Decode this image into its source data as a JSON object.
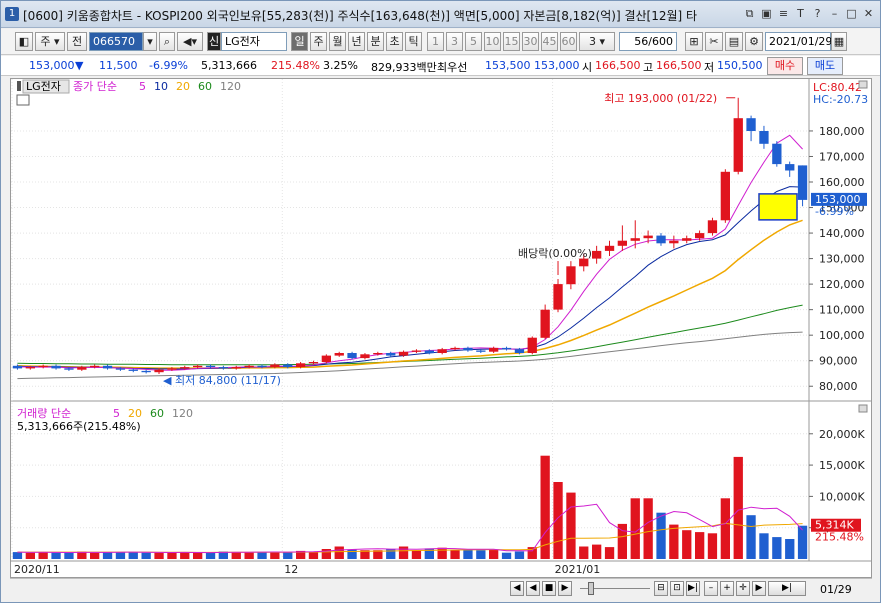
{
  "window": {
    "number": "1",
    "title": "[0600] 키움종합차트 - KOSPI200 외국인보유[55,283(천)] 주식수[163,648(천)] 액면[5,000] 자본금[8,182(억)] 결산[12월] 타"
  },
  "toolbar": {
    "market": "주",
    "prev": "전",
    "code": "066570",
    "stock_badge": "신",
    "stock_name": "LG전자",
    "periods": [
      "일",
      "주",
      "월",
      "년",
      "분",
      "초",
      "틱"
    ],
    "selected_period": "일",
    "intervals": [
      "1",
      "3",
      "5",
      "10",
      "15",
      "30",
      "45",
      "60"
    ],
    "interval_value": "3",
    "count": "56/600",
    "date": "2021/01/29"
  },
  "info": {
    "price": "153,000",
    "arrow": "▼",
    "change": "11,500",
    "change_pct": "-6.99%",
    "volume": "5,313,666",
    "volume_pct": "215.48%",
    "turnover": "3.25%",
    "amount": "829,933백만",
    "best_ask_label": "최우선",
    "best_ask": "153,500",
    "best_bid": "153,000",
    "open_label": "시",
    "open": "166,500",
    "high_label": "고",
    "high": "166,500",
    "low_label": "저",
    "low": "150,500",
    "buy_label": "매수",
    "sell_label": "매도"
  },
  "price_panel": {
    "legend_name": "LG전자",
    "legend_ma": "종가 단순",
    "ma_periods": [
      "5",
      "10",
      "20",
      "60",
      "120"
    ],
    "lc": "LC:80.42",
    "hc": "HC:-20.73",
    "y_ticks": [
      "180,000",
      "170,000",
      "160,000",
      "150,000",
      "140,000",
      "130,000",
      "120,000",
      "110,000",
      "100,000",
      "90,000",
      "80,000"
    ],
    "current_price_tag": "153,000",
    "current_pct_tag": "-6.99%",
    "high_annotation": "최고 193,000 (01/22)",
    "low_annotation": "최저 84,800 (11/17)",
    "dividend_annotation": "배당락(0.00%)"
  },
  "volume_panel": {
    "legend_name": "거래량",
    "legend_ma": "단순",
    "ma_periods": [
      "5",
      "20",
      "60",
      "120"
    ],
    "summary": "5,313,666주(215.48%)",
    "y_ticks": [
      "20,000K",
      "15,000K",
      "10,000K",
      "5,000K"
    ],
    "volume_tag": "5,314K",
    "volume_pct_tag": "215.48%"
  },
  "x_labels": [
    "2020/11",
    "12",
    "2021/01"
  ],
  "x_end_label": "01/29",
  "colors": {
    "up": "#e0141e",
    "down": "#1f5fd0",
    "ma5": "#d01fd0",
    "ma10": "#0a2aa0",
    "ma20": "#f0a800",
    "ma60": "#1c8a1c",
    "ma120": "#808080"
  },
  "chart_data": {
    "type": "candlestick",
    "x": [
      "2020-11-02",
      "2020-11-03",
      "2020-11-04",
      "2020-11-05",
      "2020-11-06",
      "2020-11-09",
      "2020-11-10",
      "2020-11-11",
      "2020-11-12",
      "2020-11-13",
      "2020-11-16",
      "2020-11-17",
      "2020-11-18",
      "2020-11-19",
      "2020-11-20",
      "2020-11-23",
      "2020-11-24",
      "2020-11-25",
      "2020-11-26",
      "2020-11-27",
      "2020-11-30",
      "2020-12-01",
      "2020-12-02",
      "2020-12-03",
      "2020-12-04",
      "2020-12-07",
      "2020-12-08",
      "2020-12-09",
      "2020-12-10",
      "2020-12-11",
      "2020-12-14",
      "2020-12-15",
      "2020-12-16",
      "2020-12-17",
      "2020-12-18",
      "2020-12-21",
      "2020-12-22",
      "2020-12-23",
      "2020-12-24",
      "2020-12-28",
      "2020-12-29",
      "2020-12-30",
      "2021-01-04",
      "2021-01-05",
      "2021-01-06",
      "2021-01-07",
      "2021-01-08",
      "2021-01-11",
      "2021-01-12",
      "2021-01-13",
      "2021-01-14",
      "2021-01-15",
      "2021-01-18",
      "2021-01-19",
      "2021-01-20",
      "2021-01-21",
      "2021-01-22",
      "2021-01-25",
      "2021-01-26",
      "2021-01-27",
      "2021-01-28",
      "2021-01-29"
    ],
    "open": [
      88000,
      87000,
      87500,
      88000,
      87000,
      86500,
      87500,
      88000,
      87000,
      86500,
      86000,
      85500,
      86500,
      87000,
      87500,
      88000,
      87500,
      87000,
      87500,
      88000,
      87500,
      88500,
      87500,
      89000,
      89500,
      92000,
      93000,
      91000,
      92500,
      93000,
      92000,
      93500,
      94000,
      93000,
      94500,
      95000,
      94000,
      93500,
      95000,
      94500,
      93000,
      99000,
      110000,
      120000,
      127000,
      130000,
      133000,
      135000,
      137000,
      138000,
      139000,
      136000,
      137000,
      138000,
      140000,
      145000,
      164000,
      185000,
      180000,
      175000,
      167000,
      166500
    ],
    "close": [
      87000,
      87500,
      88000,
      87000,
      86500,
      87500,
      88000,
      87000,
      86500,
      86000,
      85500,
      86500,
      87000,
      87500,
      88000,
      87500,
      87000,
      87500,
      88000,
      87500,
      88500,
      87500,
      89000,
      89500,
      92000,
      93000,
      91000,
      92500,
      93000,
      92000,
      93500,
      94000,
      93000,
      94500,
      95000,
      94000,
      93500,
      95000,
      94500,
      93000,
      99000,
      110000,
      120000,
      127000,
      130000,
      133000,
      135000,
      137000,
      138000,
      139000,
      136000,
      137000,
      138000,
      140000,
      145000,
      164000,
      185000,
      180000,
      175000,
      167000,
      164500,
      153000
    ],
    "high": [
      88500,
      88000,
      88500,
      88500,
      87500,
      88000,
      88500,
      88500,
      87500,
      87000,
      86500,
      87000,
      87500,
      88000,
      88500,
      88500,
      88000,
      88000,
      88500,
      88500,
      89000,
      89000,
      89500,
      90000,
      92500,
      93500,
      93500,
      93000,
      93500,
      93500,
      94000,
      94500,
      94500,
      95000,
      95500,
      95500,
      94500,
      95500,
      95500,
      95000,
      99500,
      112000,
      122000,
      129000,
      132000,
      135000,
      137000,
      143000,
      145000,
      141000,
      140000,
      139000,
      139000,
      141000,
      146000,
      165000,
      193000,
      186000,
      182000,
      176000,
      168000,
      166500
    ],
    "low": [
      86500,
      86500,
      87000,
      86500,
      86000,
      86000,
      87000,
      86500,
      86000,
      85500,
      85000,
      84800,
      86000,
      86500,
      87000,
      87000,
      86500,
      86500,
      87000,
      87000,
      87000,
      87000,
      87000,
      88500,
      89000,
      91500,
      90500,
      90500,
      92000,
      91500,
      91500,
      93000,
      92500,
      92500,
      94000,
      93500,
      93000,
      93000,
      94000,
      92500,
      92500,
      98500,
      109000,
      118000,
      125000,
      128000,
      131000,
      133000,
      134000,
      136000,
      135000,
      134000,
      136000,
      137000,
      139000,
      144000,
      163000,
      176000,
      173000,
      166000,
      162000,
      150500
    ],
    "volume_k": [
      1100,
      1000,
      1100,
      1000,
      1000,
      1200,
      1000,
      1100,
      1100,
      1100,
      1000,
      1000,
      1000,
      1100,
      1000,
      1000,
      1200,
      1100,
      1100,
      1100,
      1100,
      1100,
      1300,
      1200,
      1600,
      2000,
      1500,
      1400,
      1400,
      1600,
      2000,
      1400,
      1700,
      1800,
      1400,
      1500,
      1400,
      1500,
      1000,
      1200,
      1900,
      16500,
      12300,
      10600,
      2000,
      2300,
      1900,
      5600,
      9700,
      9700,
      7400,
      5500,
      4600,
      4300,
      4100,
      9700,
      16300,
      7000,
      4100,
      3500,
      3200,
      5314
    ],
    "ma5": [
      87600,
      87500,
      87500,
      87500,
      87200,
      87300,
      87400,
      87300,
      87100,
      86900,
      86600,
      86300,
      86300,
      86500,
      87000,
      87200,
      87300,
      87400,
      87600,
      87500,
      87800,
      87800,
      87900,
      88300,
      89200,
      90000,
      90600,
      91600,
      92400,
      92900,
      93200,
      93700,
      94000,
      94200,
      94600,
      94900,
      95000,
      94900,
      94700,
      94400,
      95300,
      98300,
      103300,
      109800,
      117200,
      123900,
      129700,
      133300,
      135600,
      136900,
      137400,
      137400,
      137300,
      137600,
      138000,
      141600,
      150800,
      159800,
      167800,
      175200,
      178300,
      172900
    ],
    "ma10": [
      87800,
      87700,
      87600,
      87600,
      87400,
      87400,
      87400,
      87300,
      87200,
      87000,
      86900,
      86800,
      86800,
      86700,
      86900,
      87000,
      87100,
      87200,
      87500,
      87500,
      87700,
      87700,
      87800,
      88100,
      88600,
      89100,
      89400,
      90000,
      90700,
      91500,
      92000,
      92500,
      93000,
      93500,
      94000,
      94300,
      94500,
      94600,
      94600,
      94500,
      95000,
      96600,
      99300,
      102800,
      106700,
      110800,
      114600,
      118900,
      123000,
      127400,
      130800,
      133500,
      135500,
      136700,
      137400,
      139300,
      144100,
      148700,
      152900,
      156300,
      158200,
      158000
    ],
    "ma20": [
      88000,
      87900,
      87800,
      87700,
      87600,
      87500,
      87500,
      87500,
      87400,
      87300,
      87200,
      87100,
      87100,
      87100,
      87100,
      87100,
      87100,
      87100,
      87200,
      87200,
      87300,
      87300,
      87400,
      87500,
      87800,
      88100,
      88300,
      88700,
      89100,
      89500,
      89900,
      90200,
      90500,
      90900,
      91300,
      91600,
      91900,
      92300,
      92700,
      93000,
      93700,
      94800,
      96200,
      97900,
      99900,
      102000,
      104000,
      106300,
      108600,
      111000,
      113200,
      115400,
      117700,
      120000,
      122300,
      125300,
      129600,
      133500,
      137200,
      140400,
      143200,
      145000
    ],
    "ma60": [
      89000,
      88900,
      88900,
      88800,
      88800,
      88700,
      88700,
      88600,
      88600,
      88600,
      88500,
      88500,
      88400,
      88400,
      88400,
      88400,
      88400,
      88400,
      88400,
      88400,
      88400,
      88500,
      88500,
      88600,
      88700,
      88800,
      88900,
      89100,
      89300,
      89500,
      89700,
      89900,
      90100,
      90300,
      90600,
      90800,
      91000,
      91200,
      91500,
      91700,
      92000,
      92500,
      93100,
      93800,
      94600,
      95500,
      96400,
      97300,
      98200,
      99200,
      100100,
      101000,
      101900,
      102800,
      103700,
      104700,
      105900,
      107200,
      108400,
      109700,
      110800,
      111800
    ],
    "ma120": [
      83000,
      83100,
      83200,
      83300,
      83400,
      83500,
      83600,
      83700,
      83800,
      83900,
      84000,
      84100,
      84200,
      84300,
      84400,
      84500,
      84600,
      84700,
      84800,
      84900,
      85000,
      85200,
      85400,
      85600,
      85800,
      86100,
      86400,
      86700,
      87000,
      87300,
      87600,
      87900,
      88200,
      88500,
      88800,
      89100,
      89300,
      89500,
      89700,
      89900,
      90200,
      90600,
      91100,
      91700,
      92300,
      92900,
      93500,
      94100,
      94700,
      95300,
      95900,
      96500,
      97000,
      97500,
      98000,
      98600,
      99200,
      99800,
      100300,
      100700,
      101000,
      101200
    ],
    "vol_ma5_k": [
      1100,
      1050,
      1070,
      1050,
      1040,
      1060,
      1060,
      1060,
      1080,
      1100,
      1080,
      1060,
      1040,
      1060,
      1040,
      1020,
      1060,
      1080,
      1080,
      1100,
      1120,
      1100,
      1140,
      1160,
      1260,
      1440,
      1520,
      1600,
      1640,
      1580,
      1580,
      1560,
      1620,
      1700,
      1660,
      1560,
      1560,
      1560,
      1320,
      1320,
      1300,
      4220,
      6580,
      8300,
      8460,
      8740,
      5820,
      4520,
      4300,
      5840,
      6860,
      7580,
      7380,
      6300,
      5180,
      5640,
      7800,
      8280,
      8040,
      8120,
      6820,
      4620
    ],
    "vol_ma20_k": [
      1100,
      1100,
      1100,
      1100,
      1100,
      1100,
      1100,
      1100,
      1100,
      1100,
      1100,
      1080,
      1070,
      1070,
      1060,
      1060,
      1070,
      1070,
      1080,
      1080,
      1090,
      1090,
      1100,
      1110,
      1140,
      1180,
      1200,
      1230,
      1260,
      1280,
      1330,
      1350,
      1380,
      1420,
      1440,
      1460,
      1480,
      1500,
      1490,
      1490,
      1530,
      2260,
      2830,
      3300,
      3320,
      3340,
      3360,
      3570,
      3980,
      4380,
      4670,
      4880,
      5030,
      5150,
      5290,
      5690,
      5450,
      5190,
      5420,
      5460,
      5530,
      5650
    ],
    "ylim": [
      75000,
      198000
    ],
    "vol_ylim_k": [
      0,
      23000
    ]
  }
}
